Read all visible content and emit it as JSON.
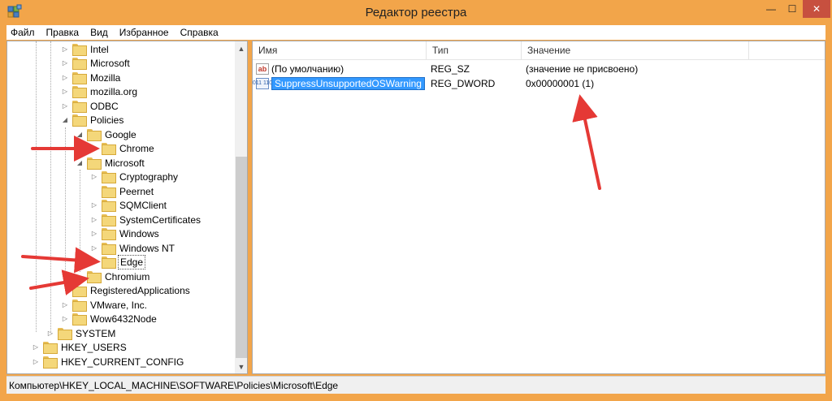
{
  "window": {
    "title": "Редактор реестра",
    "app_icon": "regedit-icon",
    "controls": {
      "minimize": "—",
      "maximize": "☐",
      "close": "✕"
    }
  },
  "menu": [
    "Файл",
    "Правка",
    "Вид",
    "Избранное",
    "Справка"
  ],
  "tree": {
    "expand_glyph": "▷",
    "collapse_glyph": "◢",
    "items": [
      {
        "label": "Intel",
        "state": "collapsed"
      },
      {
        "label": "Microsoft",
        "state": "collapsed"
      },
      {
        "label": "Mozilla",
        "state": "collapsed"
      },
      {
        "label": "mozilla.org",
        "state": "collapsed"
      },
      {
        "label": "ODBC",
        "state": "collapsed"
      },
      {
        "label": "Policies",
        "state": "expanded"
      },
      {
        "label": "Google",
        "state": "expanded"
      },
      {
        "label": "Chrome",
        "state": "leaf"
      },
      {
        "label": "Microsoft",
        "state": "expanded"
      },
      {
        "label": "Cryptography",
        "state": "collapsed"
      },
      {
        "label": "Peernet",
        "state": "leaf"
      },
      {
        "label": "SQMClient",
        "state": "collapsed"
      },
      {
        "label": "SystemCertificates",
        "state": "collapsed"
      },
      {
        "label": "Windows",
        "state": "collapsed"
      },
      {
        "label": "Windows NT",
        "state": "collapsed"
      },
      {
        "label": "Edge",
        "state": "leaf",
        "selected": true
      },
      {
        "label": "Chromium",
        "state": "leaf"
      },
      {
        "label": "RegisteredApplications",
        "state": "leaf"
      },
      {
        "label": "VMware, Inc.",
        "state": "collapsed"
      },
      {
        "label": "Wow6432Node",
        "state": "collapsed"
      },
      {
        "label": "SYSTEM",
        "state": "collapsed"
      },
      {
        "label": "HKEY_USERS",
        "state": "collapsed"
      },
      {
        "label": "HKEY_CURRENT_CONFIG",
        "state": "collapsed"
      }
    ]
  },
  "list": {
    "columns": {
      "name": "Имя",
      "type": "Тип",
      "value": "Значение"
    },
    "rows": [
      {
        "icon": "string-value-icon",
        "icon_glyph": "ab",
        "name": "(По умолчанию)",
        "type": "REG_SZ",
        "value": "(значение не присвоено)",
        "selected": false
      },
      {
        "icon": "dword-value-icon",
        "icon_glyph": "011 110",
        "name": "SuppressUnsupportedOSWarning",
        "type": "REG_DWORD",
        "value": "0x00000001 (1)",
        "selected": true
      }
    ]
  },
  "status": {
    "path": "Компьютер\\HKEY_LOCAL_MACHINE\\SOFTWARE\\Policies\\Microsoft\\Edge"
  },
  "annotations": {
    "arrow_color": "#e53935"
  },
  "theme": {
    "frame": "#f2a54a",
    "close_button": "#c7503f",
    "selection": "#3399ff",
    "folder": "#f4d77a"
  }
}
